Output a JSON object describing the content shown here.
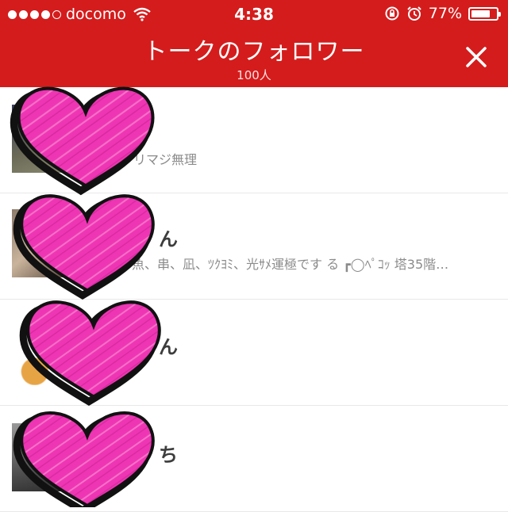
{
  "status_bar": {
    "carrier": "docomo",
    "time": "4:38",
    "battery_text": "77%",
    "battery_level": 0.77
  },
  "header": {
    "title": "トークのフォロワー",
    "subtitle": "100人"
  },
  "followers": [
    {
      "name": "",
      "status": "リマジ無理"
    },
    {
      "name": "ん",
      "status": "魚、串、凪、ﾂｸﾖﾐ、光ｻﾒ運極です る ┏◯ﾍﾟｺｯ 塔35階…"
    },
    {
      "name": "ん",
      "status": ""
    },
    {
      "name": "ち",
      "status": ""
    }
  ],
  "colors": {
    "header": "#d41c1c",
    "heart": "#ee36b4",
    "heart_outline": "#111111"
  }
}
